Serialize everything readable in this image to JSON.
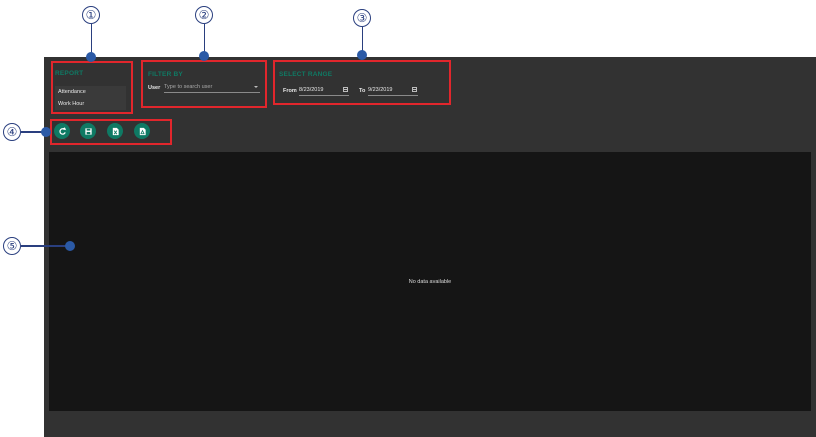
{
  "report": {
    "title": "REPORT",
    "items": [
      "Attendance",
      "Work Hour"
    ]
  },
  "filter": {
    "title": "FILTER BY",
    "user_label": "User",
    "user_placeholder": "Type to search user"
  },
  "range": {
    "title": "SELECT RANGE",
    "from_label": "From",
    "from_value": "8/23/2019",
    "to_label": "To",
    "to_value": "9/23/2019"
  },
  "toolbar": {
    "buttons": [
      "refresh-icon",
      "save-icon",
      "export-excel-icon",
      "export-pdf-icon"
    ]
  },
  "data": {
    "empty_message": "No data available"
  },
  "callouts": [
    "①",
    "②",
    "③",
    "④",
    "⑤"
  ],
  "colors": {
    "accent": "#0f7a64",
    "annotation": "#e1262c",
    "callout": "#2a3f7f",
    "panel_bg": "#323232",
    "table_bg": "#151515"
  }
}
